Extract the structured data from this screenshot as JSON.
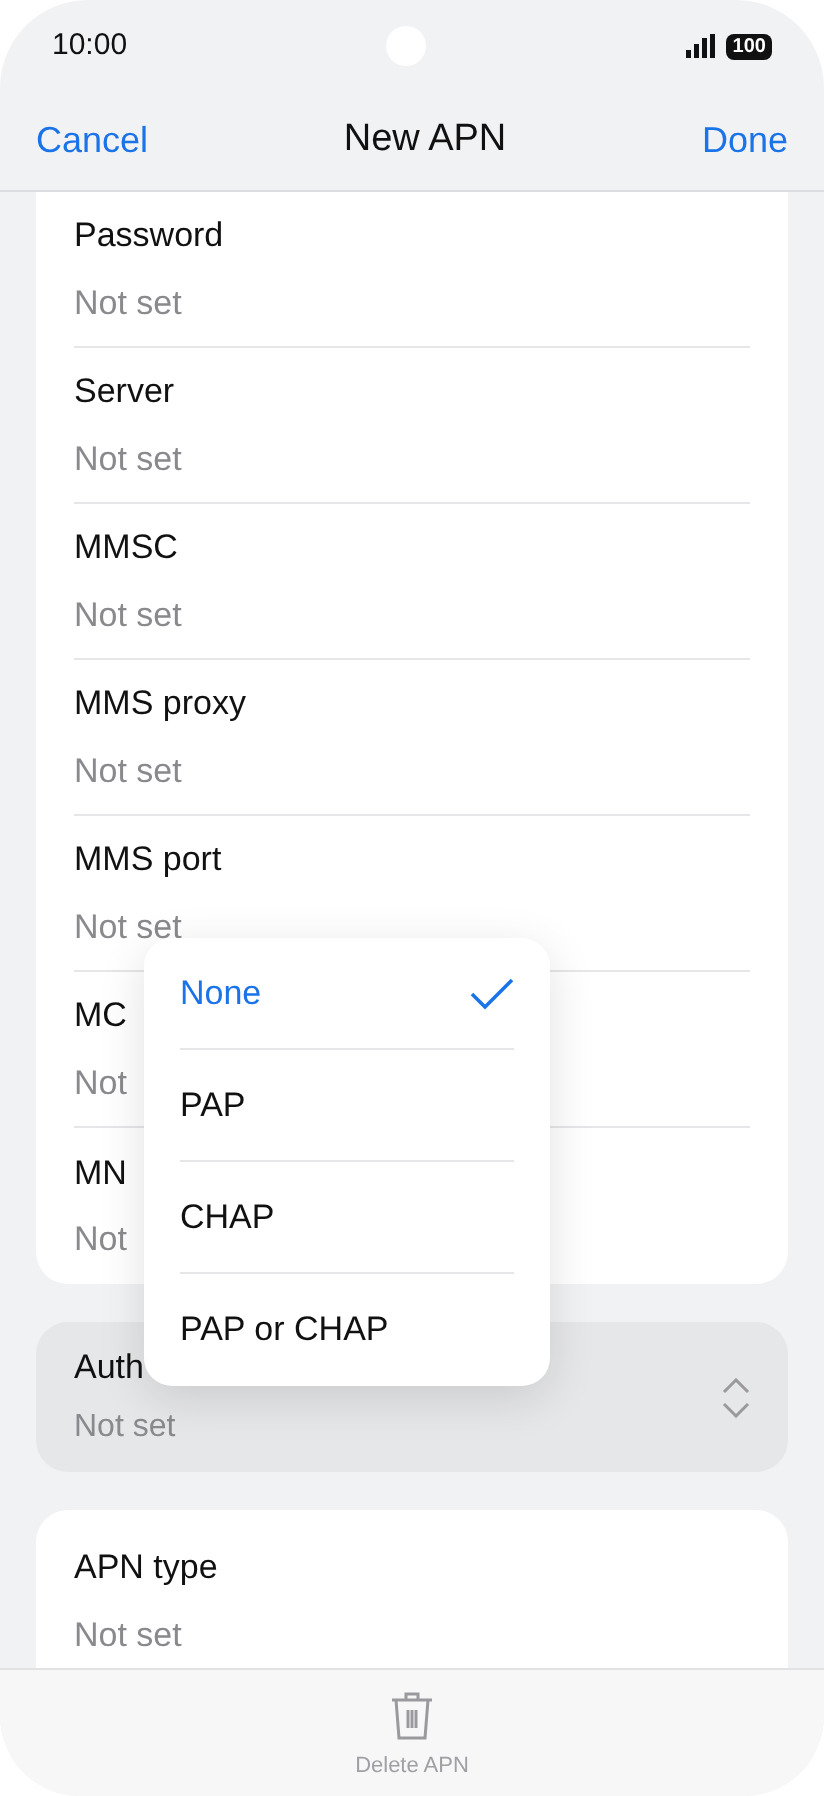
{
  "status_bar": {
    "time": "10:00",
    "battery": "100"
  },
  "nav": {
    "cancel": "Cancel",
    "title": "New APN",
    "done": "Done"
  },
  "fields": [
    {
      "label": "Password",
      "value": "Not set"
    },
    {
      "label": "Server",
      "value": "Not set"
    },
    {
      "label": "MMSC",
      "value": "Not set"
    },
    {
      "label": "MMS proxy",
      "value": "Not set"
    },
    {
      "label": "MMS port",
      "value": "Not set"
    },
    {
      "label": "MC",
      "value": "Not"
    },
    {
      "label": "MN",
      "value": "Not"
    }
  ],
  "auth_field": {
    "label": "Auth",
    "value": "Not set"
  },
  "menu": {
    "items": [
      {
        "label": "None",
        "selected": true
      },
      {
        "label": "PAP",
        "selected": false
      },
      {
        "label": "CHAP",
        "selected": false
      },
      {
        "label": "PAP or CHAP",
        "selected": false
      }
    ]
  },
  "apn_type": {
    "label": "APN type",
    "value": "Not set"
  },
  "bottom": {
    "delete_label": "Delete APN"
  }
}
